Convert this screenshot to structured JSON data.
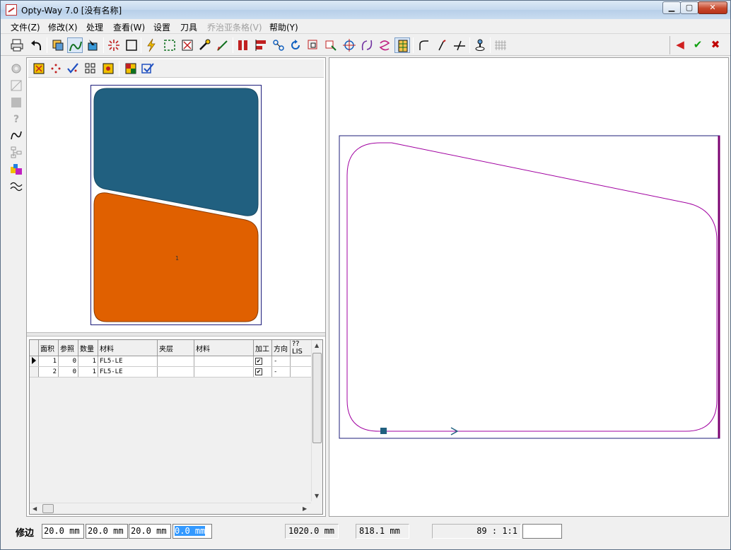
{
  "window": {
    "title": "Opty-Way 7.0  [没有名称]",
    "controls": {
      "minimize": "▁",
      "maximize": "▢",
      "close": "✕"
    }
  },
  "menu": [
    {
      "label": "文件(Z)",
      "enabled": true
    },
    {
      "label": "修改(X)",
      "enabled": true
    },
    {
      "label": "处理",
      "enabled": true
    },
    {
      "label": "查看(W)",
      "enabled": true
    },
    {
      "label": "设置",
      "enabled": true
    },
    {
      "label": "刀具",
      "enabled": true
    },
    {
      "label": "乔治亚条格(V)",
      "enabled": false
    },
    {
      "label": "帮助(Y)",
      "enabled": true
    }
  ],
  "toolbar": {
    "icons": [
      "print-icon",
      "undo-icon",
      "layers-icon",
      "path-icon",
      "select-icon",
      "explode-icon",
      "rectangle-icon",
      "lightning-icon",
      "frame-icon",
      "fit-icon",
      "tools-icon",
      "brush-icon",
      "bars-icon",
      "align-icon",
      "nodes-icon",
      "rotate-icon",
      "scale-icon",
      "mirror-icon",
      "target-icon",
      "curve-icon",
      "spiral-icon",
      "grid-layout-icon",
      "arc-icon",
      "pen-icon",
      "cut-icon",
      "stamp-icon",
      "hatch-icon"
    ],
    "confirm": {
      "back": "◀",
      "ok": "✔",
      "cancel": "✖"
    }
  },
  "sub_toolbar": {
    "icons": [
      "nest-icon",
      "points-icon",
      "check-points-icon",
      "group-icon",
      "center-icon",
      "palette-icon",
      "edit-check-icon"
    ]
  },
  "preview": {
    "part_label": "1",
    "colors": {
      "top_piece": "#216080",
      "bottom_piece": "#e06000",
      "border": "#1c1c7a"
    }
  },
  "grid": {
    "headers": [
      "面积",
      "参照",
      "数量",
      "材料",
      "夹层",
      "材料",
      "加工",
      "方向",
      "??LIS"
    ],
    "rows": [
      {
        "area": "1",
        "ref": "0",
        "qty": "1",
        "material": "FL5-LE",
        "layer": "",
        "material2": "",
        "process": "✔",
        "direction": "-"
      },
      {
        "area": "2",
        "ref": "0",
        "qty": "1",
        "material": "FL5-LE",
        "layer": "",
        "material2": "",
        "process": "✔",
        "direction": "-"
      }
    ]
  },
  "status": {
    "label": "修边",
    "trim": [
      "20.0 mm",
      "20.0 mm",
      "20.0 mm",
      "0.0 mm"
    ],
    "width": "1020.0 mm",
    "height": "818.1 mm",
    "zoom": "89 :   1:1",
    "extra": ""
  },
  "colors": {
    "path": "#a000a0",
    "frame": "#1c1c7a",
    "marker": "#216080"
  }
}
